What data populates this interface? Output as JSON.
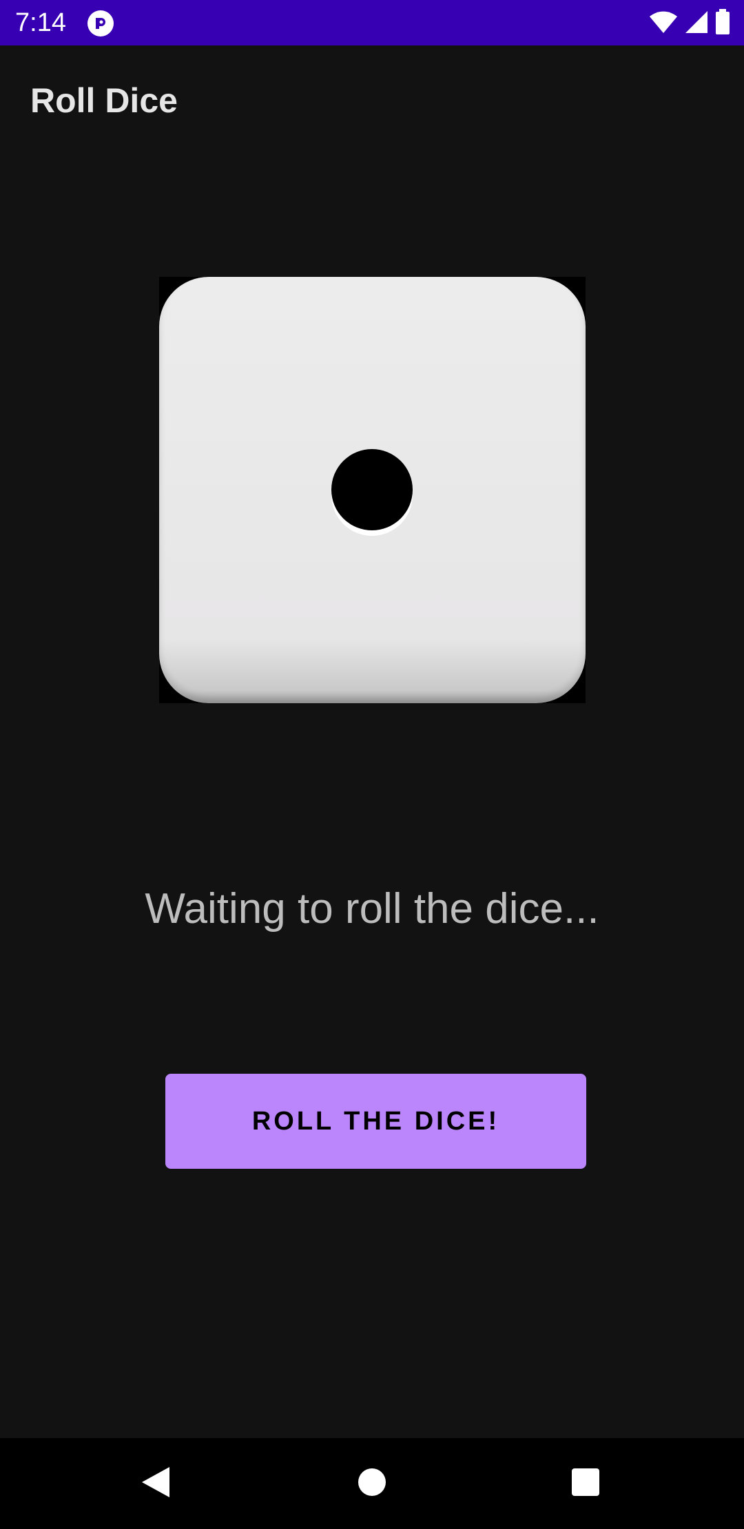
{
  "status_bar": {
    "time": "7:14",
    "icons": [
      "app-notification-icon",
      "wifi-icon",
      "cellular-signal-icon",
      "battery-icon"
    ],
    "background_color": "#3700B3"
  },
  "app_bar": {
    "title": "Roll Dice"
  },
  "dice": {
    "value": 1,
    "icon": "dice-one-icon"
  },
  "result": {
    "text": "Waiting to roll the dice..."
  },
  "actions": {
    "roll_label": "ROLL THE DICE!",
    "button_color": "#BB86FC"
  },
  "nav_bar": {
    "buttons": [
      "back-icon",
      "home-icon",
      "recents-icon"
    ]
  }
}
